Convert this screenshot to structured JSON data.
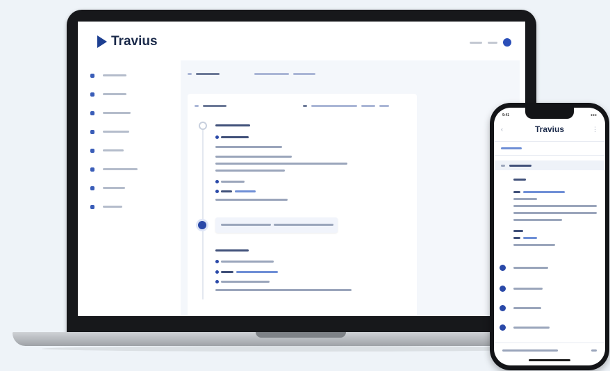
{
  "laptop_app": {
    "brand": "Travius",
    "accent_color": "#1d3f91",
    "sidebar_item_count": 8,
    "icons": [
      "logo-chevron-icon",
      "user-avatar-icon",
      "timeline-dot-icon"
    ]
  },
  "phone_app": {
    "title": "Travius",
    "status_time": "9:41",
    "status_right": "●●●",
    "icons": [
      "back-chevron-icon",
      "menu-icon",
      "timeline-dot-icon"
    ]
  }
}
